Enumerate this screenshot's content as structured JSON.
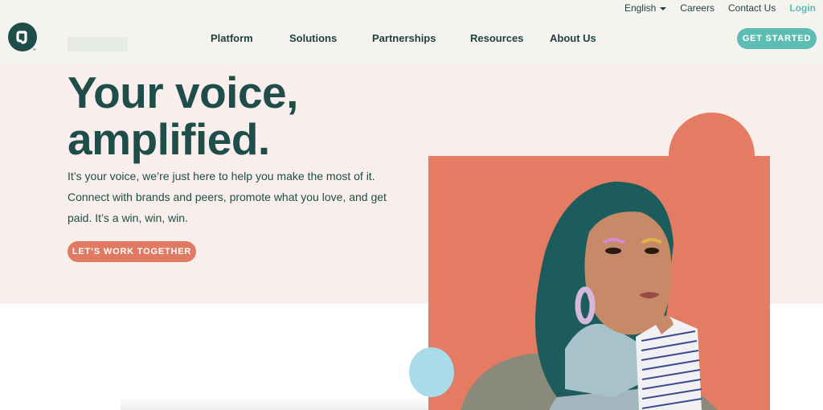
{
  "topbar": {
    "language": "English",
    "careers": "Careers",
    "contact": "Contact Us",
    "login": "Login"
  },
  "brand": {
    "logo_text": "CJ",
    "trademark": "™"
  },
  "nav": {
    "items": [
      {
        "label": "Platform"
      },
      {
        "label": "Solutions"
      },
      {
        "label": "Partnerships"
      },
      {
        "label": "Resources"
      },
      {
        "label": "About Us"
      }
    ]
  },
  "header_cta": "GET STARTED",
  "hero": {
    "headline_line1": "Your voice,",
    "headline_line2": "amplified.",
    "body": "It’s your voice, we’re just here to help you make the most of it. Connect with brands and peers, promote what you love, and get paid. It’s a win, win, win.",
    "cta": "LET’S WORK TOGETHER"
  },
  "colors": {
    "brand_dark": "#1f4d4a",
    "teal": "#5ebdb3",
    "coral": "#e07a63",
    "hero_bg": "#f8eeeb",
    "light_blue": "#a9dbe9"
  },
  "icons": {
    "language_dropdown": "chevron-down-icon",
    "logo": "cj-logo-icon"
  }
}
